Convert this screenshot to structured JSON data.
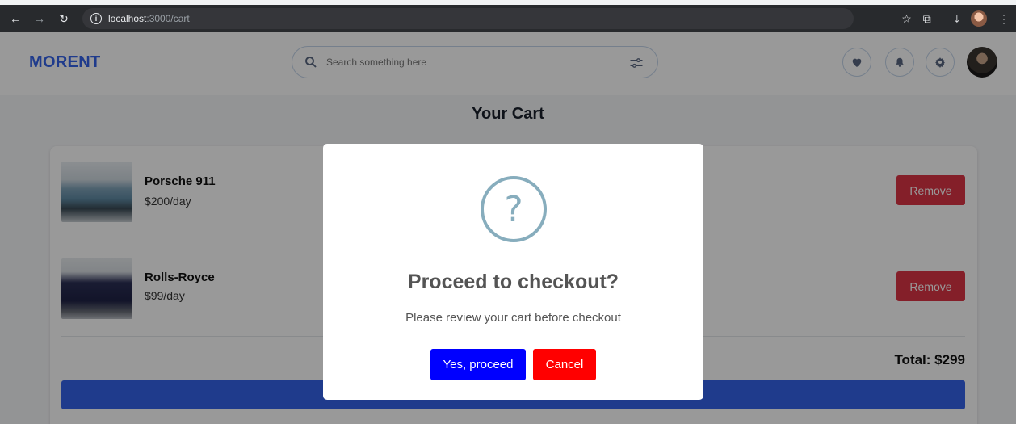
{
  "browser": {
    "url_host": "localhost",
    "url_path": ":3000/cart"
  },
  "header": {
    "logo": "MORENT",
    "search_placeholder": "Search something here"
  },
  "cart": {
    "title": "Your Cart",
    "items": [
      {
        "name": "Porsche 911",
        "price": "$200/day",
        "remove_label": "Remove"
      },
      {
        "name": "Rolls-Royce",
        "price": "$99/day",
        "remove_label": "Remove"
      }
    ],
    "total": "Total: $299"
  },
  "modal": {
    "icon_glyph": "?",
    "title": "Proceed to checkout?",
    "text": "Please review your cart before checkout",
    "confirm_label": "Yes, proceed",
    "cancel_label": "Cancel"
  },
  "colors": {
    "brand": "#3563e9",
    "remove": "#dc3545",
    "confirm": "#0000ff",
    "cancel": "#ff0000",
    "question_icon": "#87adbd"
  }
}
